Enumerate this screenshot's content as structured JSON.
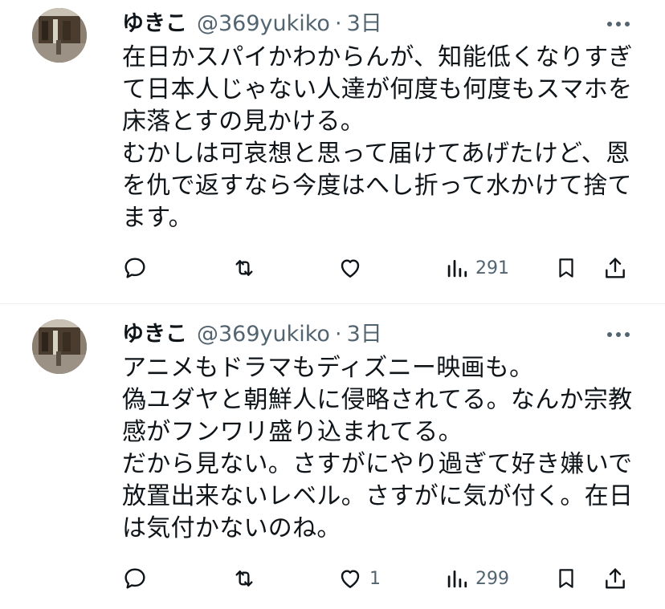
{
  "tweets": [
    {
      "author_name": "ゆきこ",
      "handle": "@369yukiko",
      "separator": "·",
      "time": "3日",
      "text": "在日かスパイかわからんが、知能低くなりすぎ\nて日本人じゃない人達が何度も何度もスマホを\n床落とすの見かける。\nむかしは可哀想と思って届けてあげたけど、恩\nを仇で返すなら今度はへし折って水かけて捨て\nます。",
      "actions": {
        "reply_icon": "reply-icon",
        "retweet_icon": "retweet-icon",
        "like_icon": "heart-icon",
        "like_count": "",
        "views_icon": "views-icon",
        "views_count": "291",
        "bookmark_icon": "bookmark-icon",
        "share_icon": "share-icon"
      }
    },
    {
      "author_name": "ゆきこ",
      "handle": "@369yukiko",
      "separator": "·",
      "time": "3日",
      "text": "アニメもドラマもディズニー映画も。\n偽ユダヤと朝鮮人に侵略されてる。なんか宗教\n感がフンワリ盛り込まれてる。\nだから見ない。さすがにやり過ぎて好き嫌いで\n放置出来ないレベル。さすがに気が付く。在日\nは気付かないのね。",
      "actions": {
        "reply_icon": "reply-icon",
        "retweet_icon": "retweet-icon",
        "like_icon": "heart-icon",
        "like_count": "1",
        "views_icon": "views-icon",
        "views_count": "299",
        "bookmark_icon": "bookmark-icon",
        "share_icon": "share-icon"
      }
    }
  ],
  "colors": {
    "text_primary": "#0f1419",
    "text_secondary": "#536471",
    "separator": "#eff3f4",
    "background": "#ffffff"
  }
}
